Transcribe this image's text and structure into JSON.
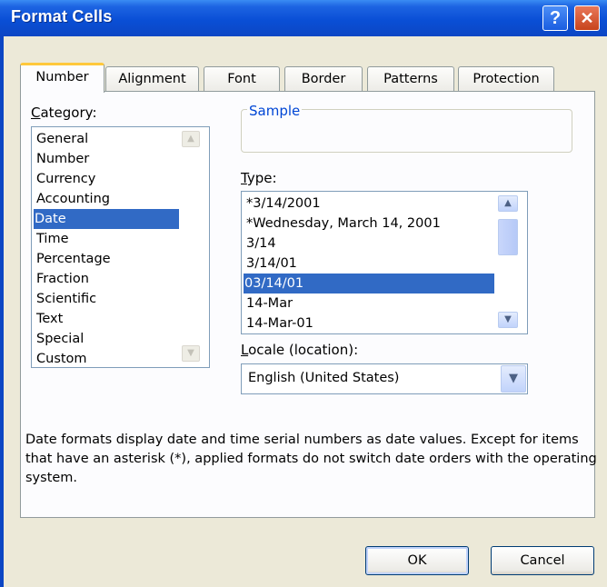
{
  "window": {
    "title": "Format Cells",
    "help_label": "?",
    "close_label": "✕"
  },
  "tabs": [
    {
      "label": "Number",
      "active": true
    },
    {
      "label": "Alignment"
    },
    {
      "label": "Font"
    },
    {
      "label": "Border"
    },
    {
      "label": "Patterns"
    },
    {
      "label": "Protection"
    }
  ],
  "category": {
    "label_u": "C",
    "label_rest": "ategory:",
    "items": [
      "General",
      "Number",
      "Currency",
      "Accounting",
      "Date",
      "Time",
      "Percentage",
      "Fraction",
      "Scientific",
      "Text",
      "Special",
      "Custom"
    ],
    "selected": "Date"
  },
  "sample": {
    "label": "Sample",
    "value": ""
  },
  "type": {
    "label_u": "T",
    "label_rest": "ype:",
    "items": [
      "*3/14/2001",
      "*Wednesday, March 14, 2001",
      "3/14",
      "3/14/01",
      "03/14/01",
      "14-Mar",
      "14-Mar-01"
    ],
    "selected": "03/14/01"
  },
  "locale": {
    "label_u": "L",
    "label_rest": "ocale (location):",
    "value": "English (United States)"
  },
  "description": "Date formats display date and time serial numbers as date values. Except for items that have an asterisk (*), applied formats do not switch date orders with the operating system.",
  "buttons": {
    "ok": "OK",
    "cancel": "Cancel"
  },
  "icons": {
    "scroll_up": "▲",
    "scroll_down": "▼",
    "dropdown": "▼"
  },
  "colors": {
    "titlebar": "#0c46c4",
    "selection": "#316ac5",
    "dialog_bg": "#ece9d8",
    "tab_highlight": "#ffc83c"
  }
}
